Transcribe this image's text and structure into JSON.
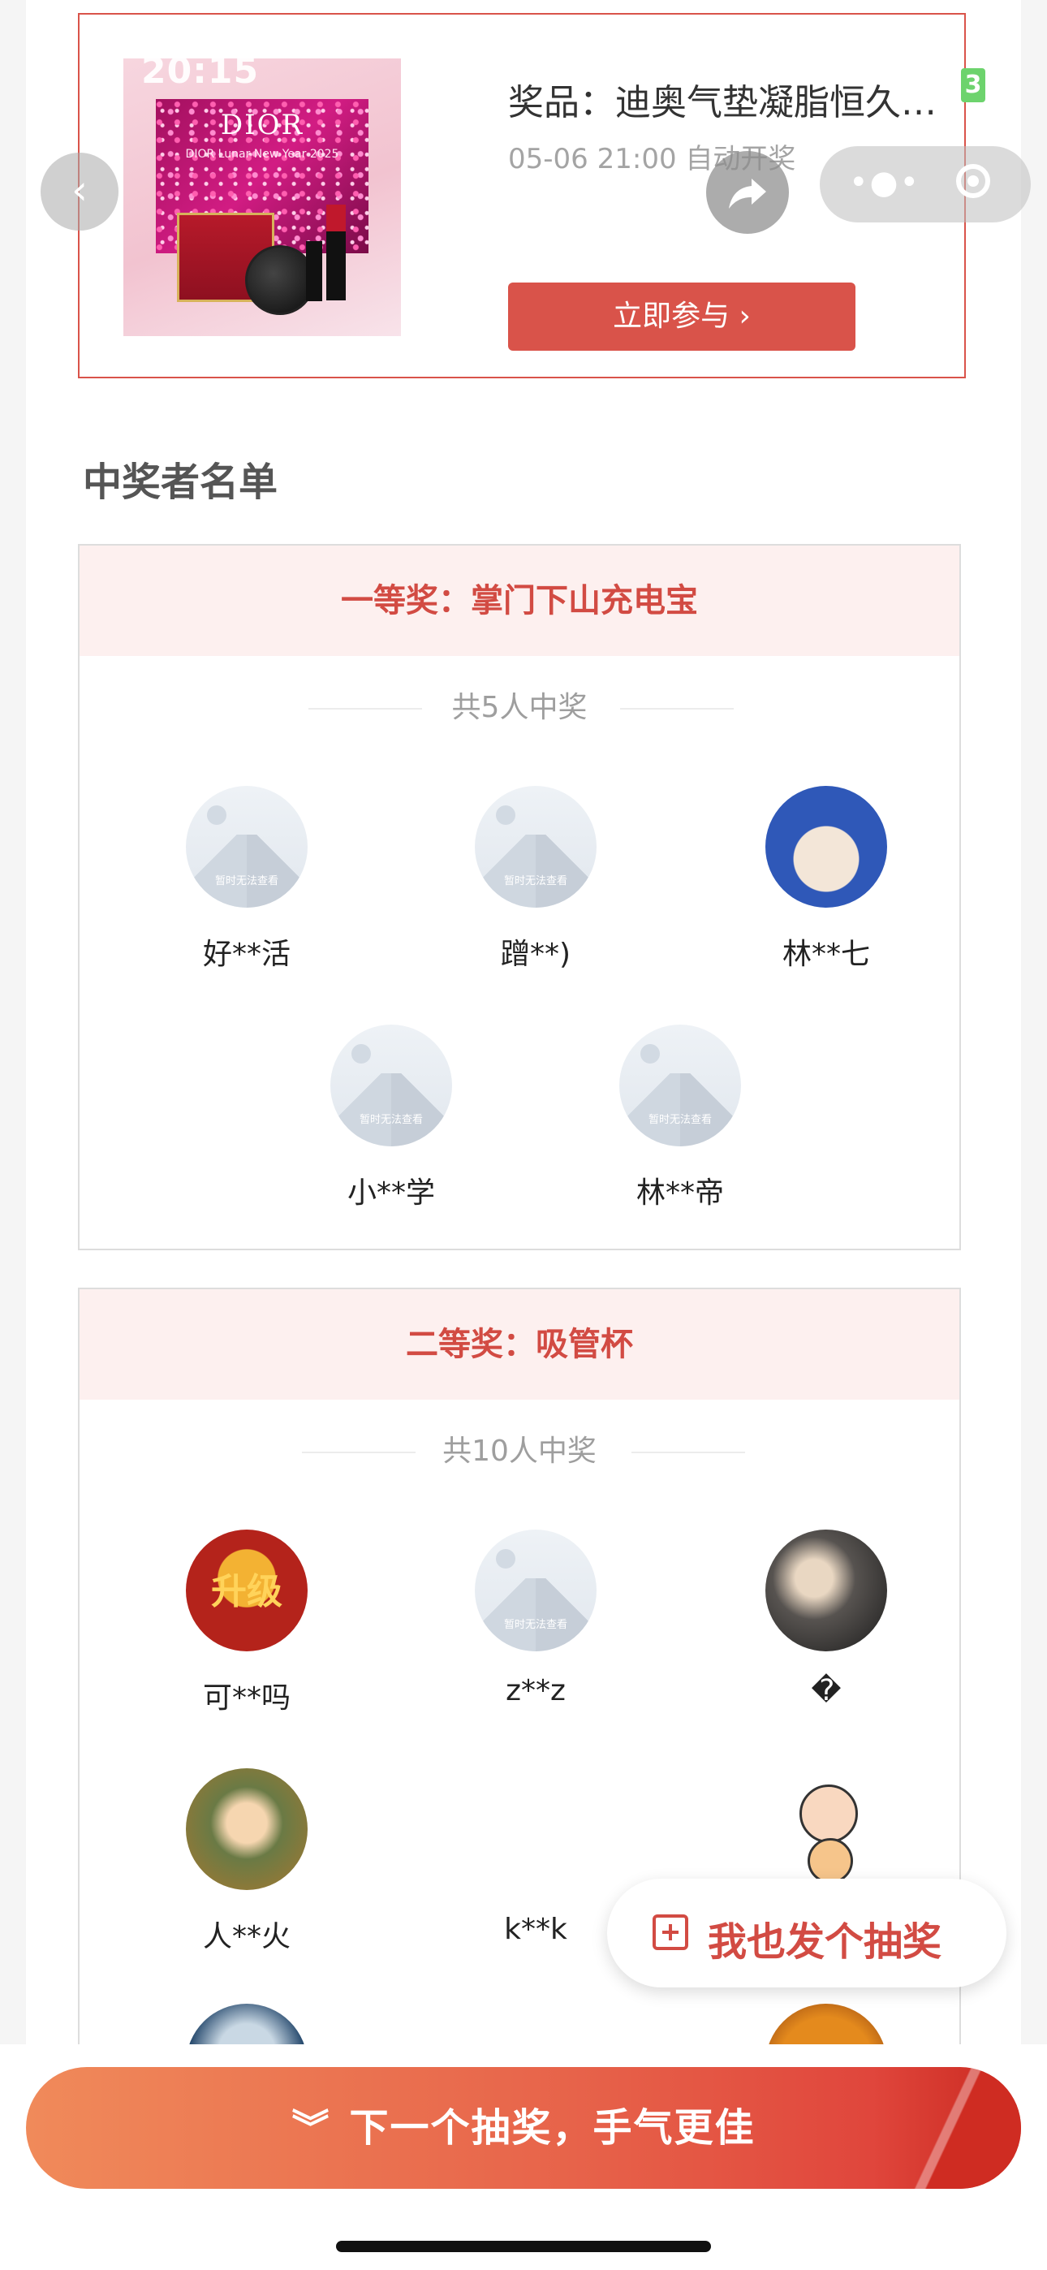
{
  "status": {
    "time": "20:15"
  },
  "prize": {
    "title": "奖品：迪奥气垫凝脂恒久…",
    "badge": "3",
    "open_time": "05-06 21:00 自动开奖",
    "join_label": "立即参与 ›",
    "image": {
      "brand": "DIOR",
      "subtitle": "DIOR Lunar New Year 2025"
    }
  },
  "nav": {
    "back_icon": "chevron-left-icon",
    "share_icon": "share-icon",
    "more_icon": "more-dots-icon",
    "close_icon": "target-icon"
  },
  "winners": {
    "title": "中奖者名单",
    "placeholder_text": "暂时无法查看",
    "groups": [
      {
        "header": "一等奖：掌门下山充电宝",
        "count": "共5人中奖",
        "members": [
          {
            "name": "好**活",
            "avatar": "placeholder"
          },
          {
            "name": "蹭**)",
            "avatar": "placeholder"
          },
          {
            "name": "林**七",
            "avatar": "anime"
          },
          {
            "name": "小**学",
            "avatar": "placeholder"
          },
          {
            "name": "林**帝",
            "avatar": "placeholder"
          }
        ]
      },
      {
        "header": "二等奖：吸管杯",
        "count": "共10人中奖",
        "members": [
          {
            "name": "可**吗",
            "avatar": "game",
            "avatar_text": "升级"
          },
          {
            "name": "z**z",
            "avatar": "placeholder"
          },
          {
            "name": "�",
            "avatar": "photo"
          },
          {
            "name": "人**火",
            "avatar": "kid"
          },
          {
            "name": "k**k",
            "avatar": "hidden"
          },
          {
            "name": "",
            "avatar": "cartoon"
          }
        ]
      }
    ]
  },
  "fab": {
    "label": "我也发个抽奖",
    "icon": "plus-square-icon"
  },
  "next": {
    "label": "下一个抽奖，手气更佳",
    "icon": "double-chevron-down-icon"
  },
  "colors": {
    "accent": "#d9534a",
    "header_bg": "#fdf0ef",
    "button_gradient_start": "#f08a5a",
    "button_gradient_end": "#c9281f"
  }
}
